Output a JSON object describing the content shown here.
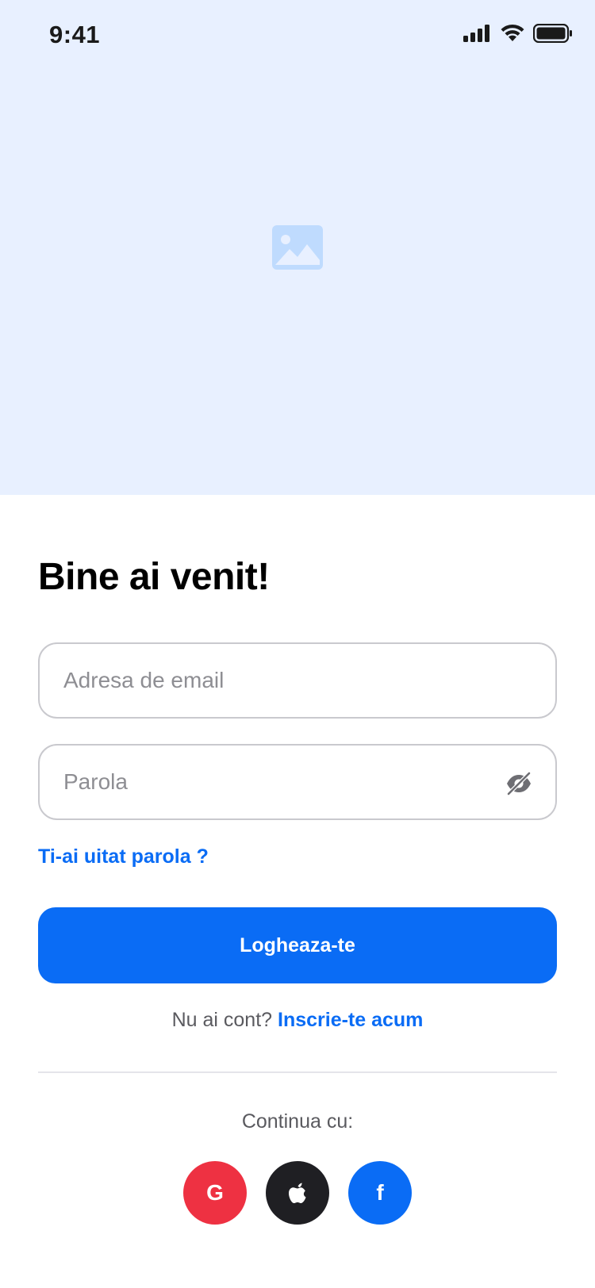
{
  "status_bar": {
    "time": "9:41"
  },
  "hero": {
    "background_color": "#E8F0FF",
    "image_icon": "image-placeholder-icon"
  },
  "login": {
    "title": "Bine ai venit!",
    "email_placeholder": "Adresa de email",
    "email_value": "",
    "password_placeholder": "Parola",
    "password_value": "",
    "forgot_password": "Ti-ai uitat parola ?",
    "login_button": "Logheaza-te",
    "no_account_text": "Nu ai cont?",
    "signup_link": "Inscrie-te acum"
  },
  "social": {
    "continue_label": "Continua cu:",
    "google": {
      "glyph": "G",
      "color": "#EE3142",
      "icon": "google-icon"
    },
    "apple": {
      "color": "#1F1F23",
      "icon": "apple-icon"
    },
    "facebook": {
      "glyph": "f",
      "color": "#0A6CF5",
      "icon": "facebook-icon"
    }
  },
  "colors": {
    "accent": "#0A6CF5",
    "border": "#C9C9CE",
    "muted_text": "#5A5A5F",
    "placeholder": "#8E8E93"
  }
}
